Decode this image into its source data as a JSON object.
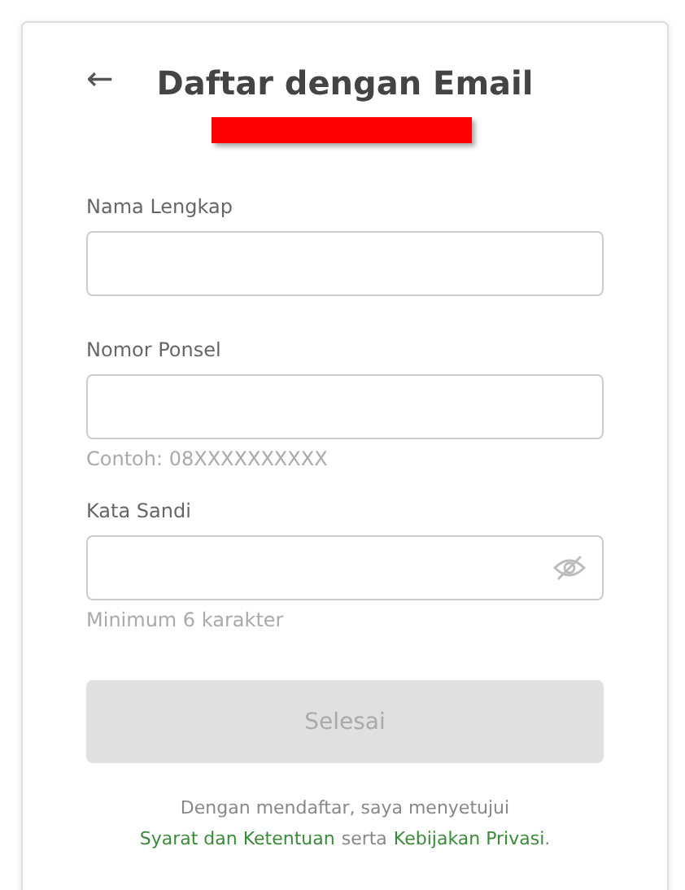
{
  "header": {
    "back": "←",
    "title": "Daftar dengan Email"
  },
  "fields": [
    {
      "label": "Nama Lengkap",
      "kind": "text"
    },
    {
      "label": "Nomor Ponsel",
      "kind": "text",
      "hint": "Contoh: 08XXXXXXXXXX"
    },
    {
      "label": "Kata Sandi",
      "kind": "password",
      "hint": "Minimum 6 karakter"
    }
  ],
  "submit": {
    "label": "Selesai",
    "disabled": true
  },
  "consent": {
    "intro": "Dengan mendaftar, saya menyetujui",
    "terms_link": "Syarat dan Ketentuan",
    "joiner": "serta",
    "privacy_link": "Kebijakan Privasi",
    "end": "."
  }
}
